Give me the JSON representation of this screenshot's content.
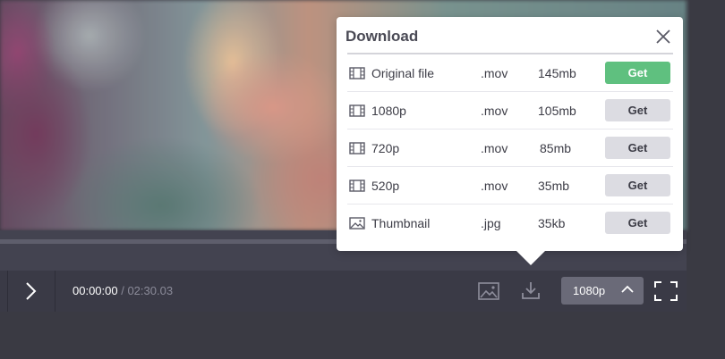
{
  "player": {
    "current_time": "00:00:00",
    "time_separator": " / ",
    "total_time": "02:30.03",
    "quality": "1080p"
  },
  "icons": {
    "next": "chevron-right-icon",
    "thumbnail": "image-icon",
    "download": "download-icon",
    "quality_toggle": "chevron-up-icon",
    "fullscreen": "fullscreen-icon",
    "close": "close-icon",
    "video_file": "film-icon",
    "image_file": "image-icon"
  },
  "colors": {
    "get_primary": "#5fc07f",
    "get_default": "#dcdce2",
    "player_bar": "#434350",
    "quality_button": "#6a6a78"
  },
  "download_popover": {
    "title": "Download",
    "rows": [
      {
        "name": "Original file",
        "ext": ".mov",
        "size": "145mb",
        "action": "Get",
        "icon": "film-icon",
        "primary": true
      },
      {
        "name": "1080p",
        "ext": ".mov",
        "size": "105mb",
        "action": "Get",
        "icon": "film-icon",
        "primary": false
      },
      {
        "name": "720p",
        "ext": ".mov",
        "size": "85mb",
        "action": "Get",
        "icon": "film-icon",
        "primary": false
      },
      {
        "name": "520p",
        "ext": ".mov",
        "size": "35mb",
        "action": "Get",
        "icon": "film-icon",
        "primary": false
      },
      {
        "name": "Thumbnail",
        "ext": ".jpg",
        "size": "35kb",
        "action": "Get",
        "icon": "image-icon",
        "primary": false
      }
    ]
  }
}
